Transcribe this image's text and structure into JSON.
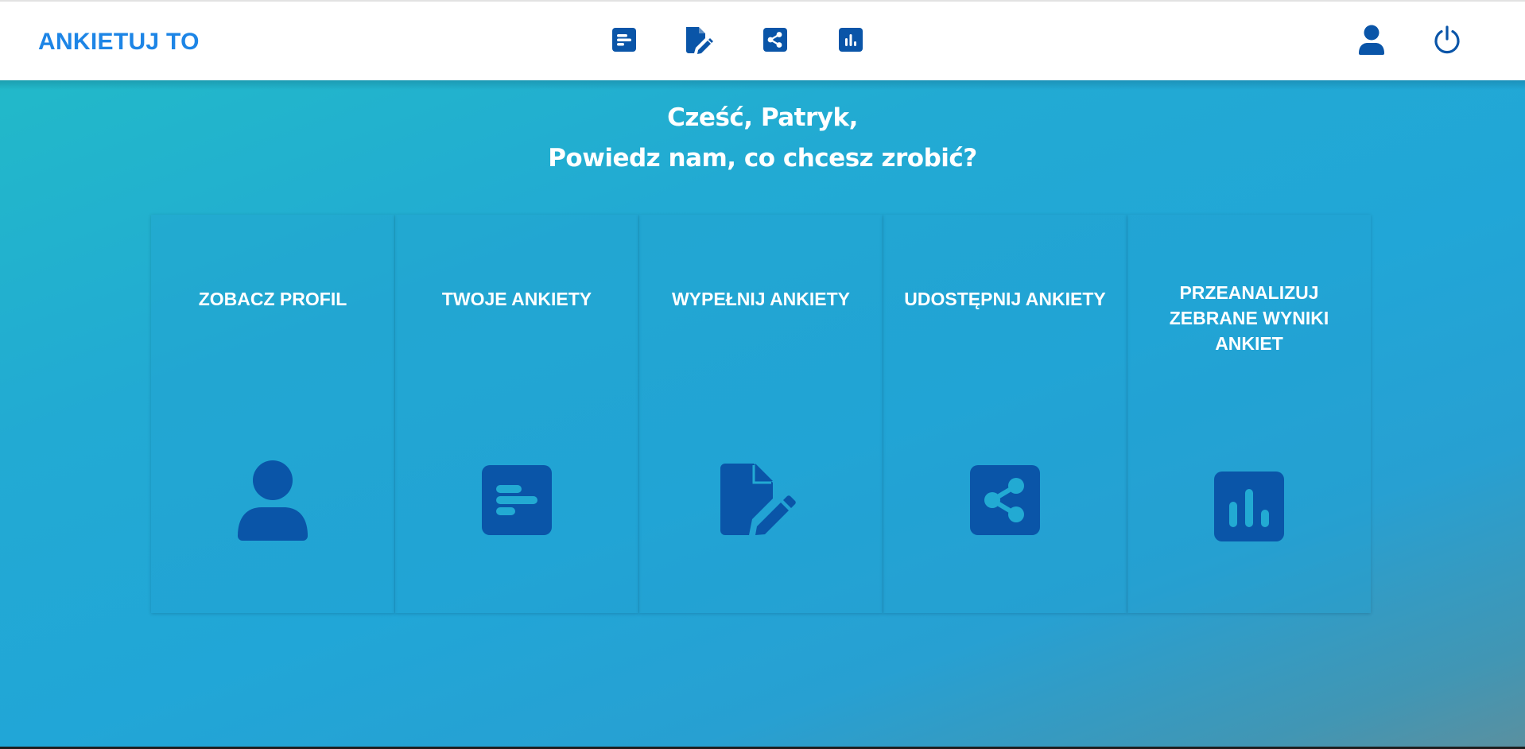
{
  "brand": {
    "title": "ANKIETUJ TO"
  },
  "navbar": {
    "icons": [
      "surveys-list-icon",
      "edit-document-icon",
      "share-icon",
      "bar-chart-icon"
    ],
    "right_icons": [
      "user-icon",
      "power-icon"
    ]
  },
  "greeting": {
    "line1": "Cześć, Patryk,",
    "line2": "Powiedz nam, co chcesz zrobić?"
  },
  "cards": [
    {
      "label": "ZOBACZ PROFIL",
      "icon": "user-icon"
    },
    {
      "label": "TWOJE ANKIETY",
      "icon": "surveys-list-icon"
    },
    {
      "label": "WYPEŁNIJ ANKIETY",
      "icon": "edit-document-icon"
    },
    {
      "label": "UDOSTĘPNIJ ANKIETY",
      "icon": "share-icon"
    },
    {
      "label": "PRZEANALIZUJ ZEBRANE WYNIKI ANKIET",
      "icon": "bar-chart-icon"
    }
  ],
  "colors": {
    "brand": "#1d85e6",
    "icon": "#0a55a8",
    "icon_inner": "#22aad3",
    "text_on_bg": "#ffffff",
    "navbar_bg": "#ffffff"
  }
}
